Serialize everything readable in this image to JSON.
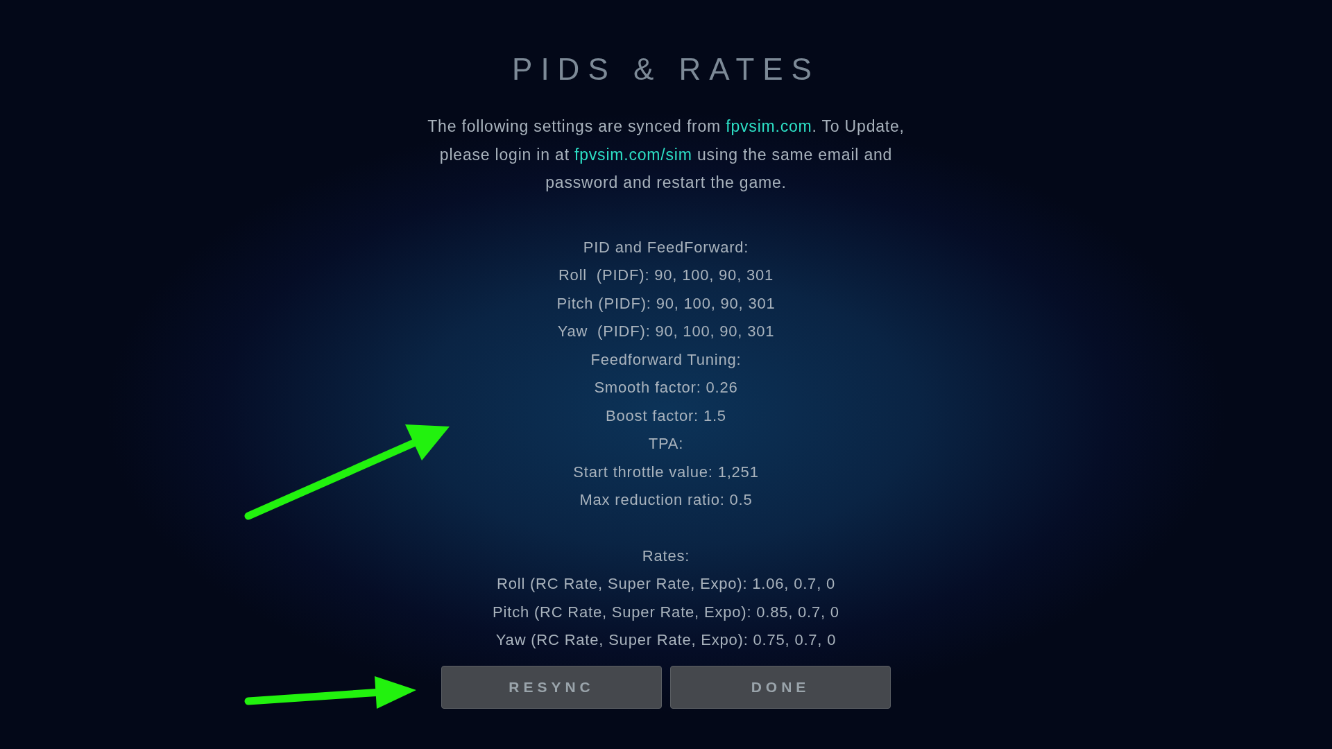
{
  "title": "PIDS & RATES",
  "intro": [
    {
      "kind": "text",
      "text": "The following settings are synced from "
    },
    {
      "kind": "link",
      "text": "fpvsim.com"
    },
    {
      "kind": "text",
      "text": ".  To Update, please login in at "
    },
    {
      "kind": "link",
      "text": "fpvsim.com/sim"
    },
    {
      "kind": "text",
      "text": " using the same email and password and restart the game."
    }
  ],
  "sections": [
    {
      "lines": [
        "PID and FeedForward:",
        "Roll  (PIDF): 90, 100, 90, 301",
        "Pitch (PIDF): 90, 100, 90, 301",
        "Yaw  (PIDF): 90, 100, 90, 301",
        "Feedforward Tuning:",
        "Smooth factor: 0.26",
        "Boost factor: 1.5",
        "TPA:",
        "Start throttle value: 1,251",
        "Max reduction ratio: 0.5"
      ]
    },
    {
      "lines": [
        "Rates:",
        "Roll (RC Rate, Super Rate, Expo): 1.06, 0.7, 0",
        "Pitch (RC Rate, Super Rate, Expo): 0.85, 0.7, 0",
        "Yaw (RC Rate, Super Rate, Expo): 0.75, 0.7, 0"
      ]
    }
  ],
  "buttons": [
    "RESYNC",
    "DONE"
  ]
}
